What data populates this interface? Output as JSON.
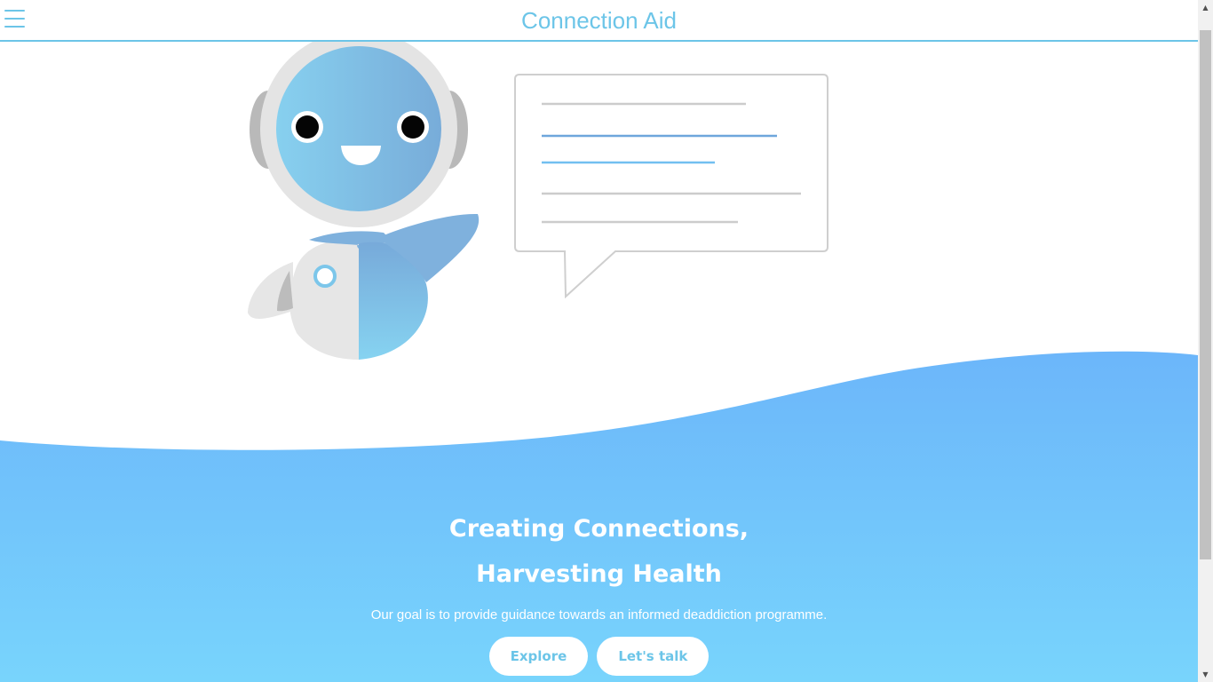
{
  "app": {
    "title": "Connection Aid"
  },
  "header": {
    "menu_icon": "hamburger-menu-icon"
  },
  "hero": {
    "headline_line1": "Creating Connections,",
    "headline_line2": "Harvesting Health",
    "subtitle": "Our goal is to provide guidance towards an informed deaddiction programme.",
    "buttons": {
      "explore": "Explore",
      "talk": "Let's talk"
    }
  },
  "illustration": {
    "subject": "robot-assistant-with-speech-bubble"
  },
  "colors": {
    "accent": "#6cc5e8",
    "wave_top": "#6cb6fa",
    "wave_bottom": "#78d4fc",
    "robot_blue": "#7fb5e0",
    "robot_gray": "#e6e6e6"
  },
  "scrollbar": {
    "up_icon": "scroll-up-arrow-icon",
    "down_icon": "scroll-down-arrow-icon"
  }
}
